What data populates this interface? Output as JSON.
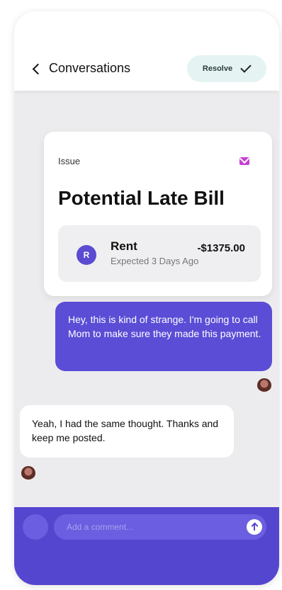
{
  "header": {
    "back_label": "Conversations",
    "resolve_label": "Resolve"
  },
  "issue": {
    "label": "Issue",
    "title": "Potential Late Bill",
    "bill": {
      "avatar_initial": "R",
      "name": "Rent",
      "amount": "-$1375.00",
      "subtitle": "Expected 3 Days Ago"
    }
  },
  "messages": [
    {
      "direction": "outgoing",
      "text": "Hey, this is kind of strange. I'm going to call Mom to make sure they made this payment."
    },
    {
      "direction": "incoming",
      "text": "Yeah, I had the same thought. Thanks and keep me posted."
    }
  ],
  "composer": {
    "placeholder": "Add a comment..."
  },
  "colors": {
    "accent": "#5b4dd6",
    "resolve_bg": "#e5f4f2",
    "mail_icon": "#c73ed6"
  },
  "icons": [
    "chevron-left-icon",
    "checkmark-icon",
    "mail-icon",
    "send-arrow-icon"
  ]
}
